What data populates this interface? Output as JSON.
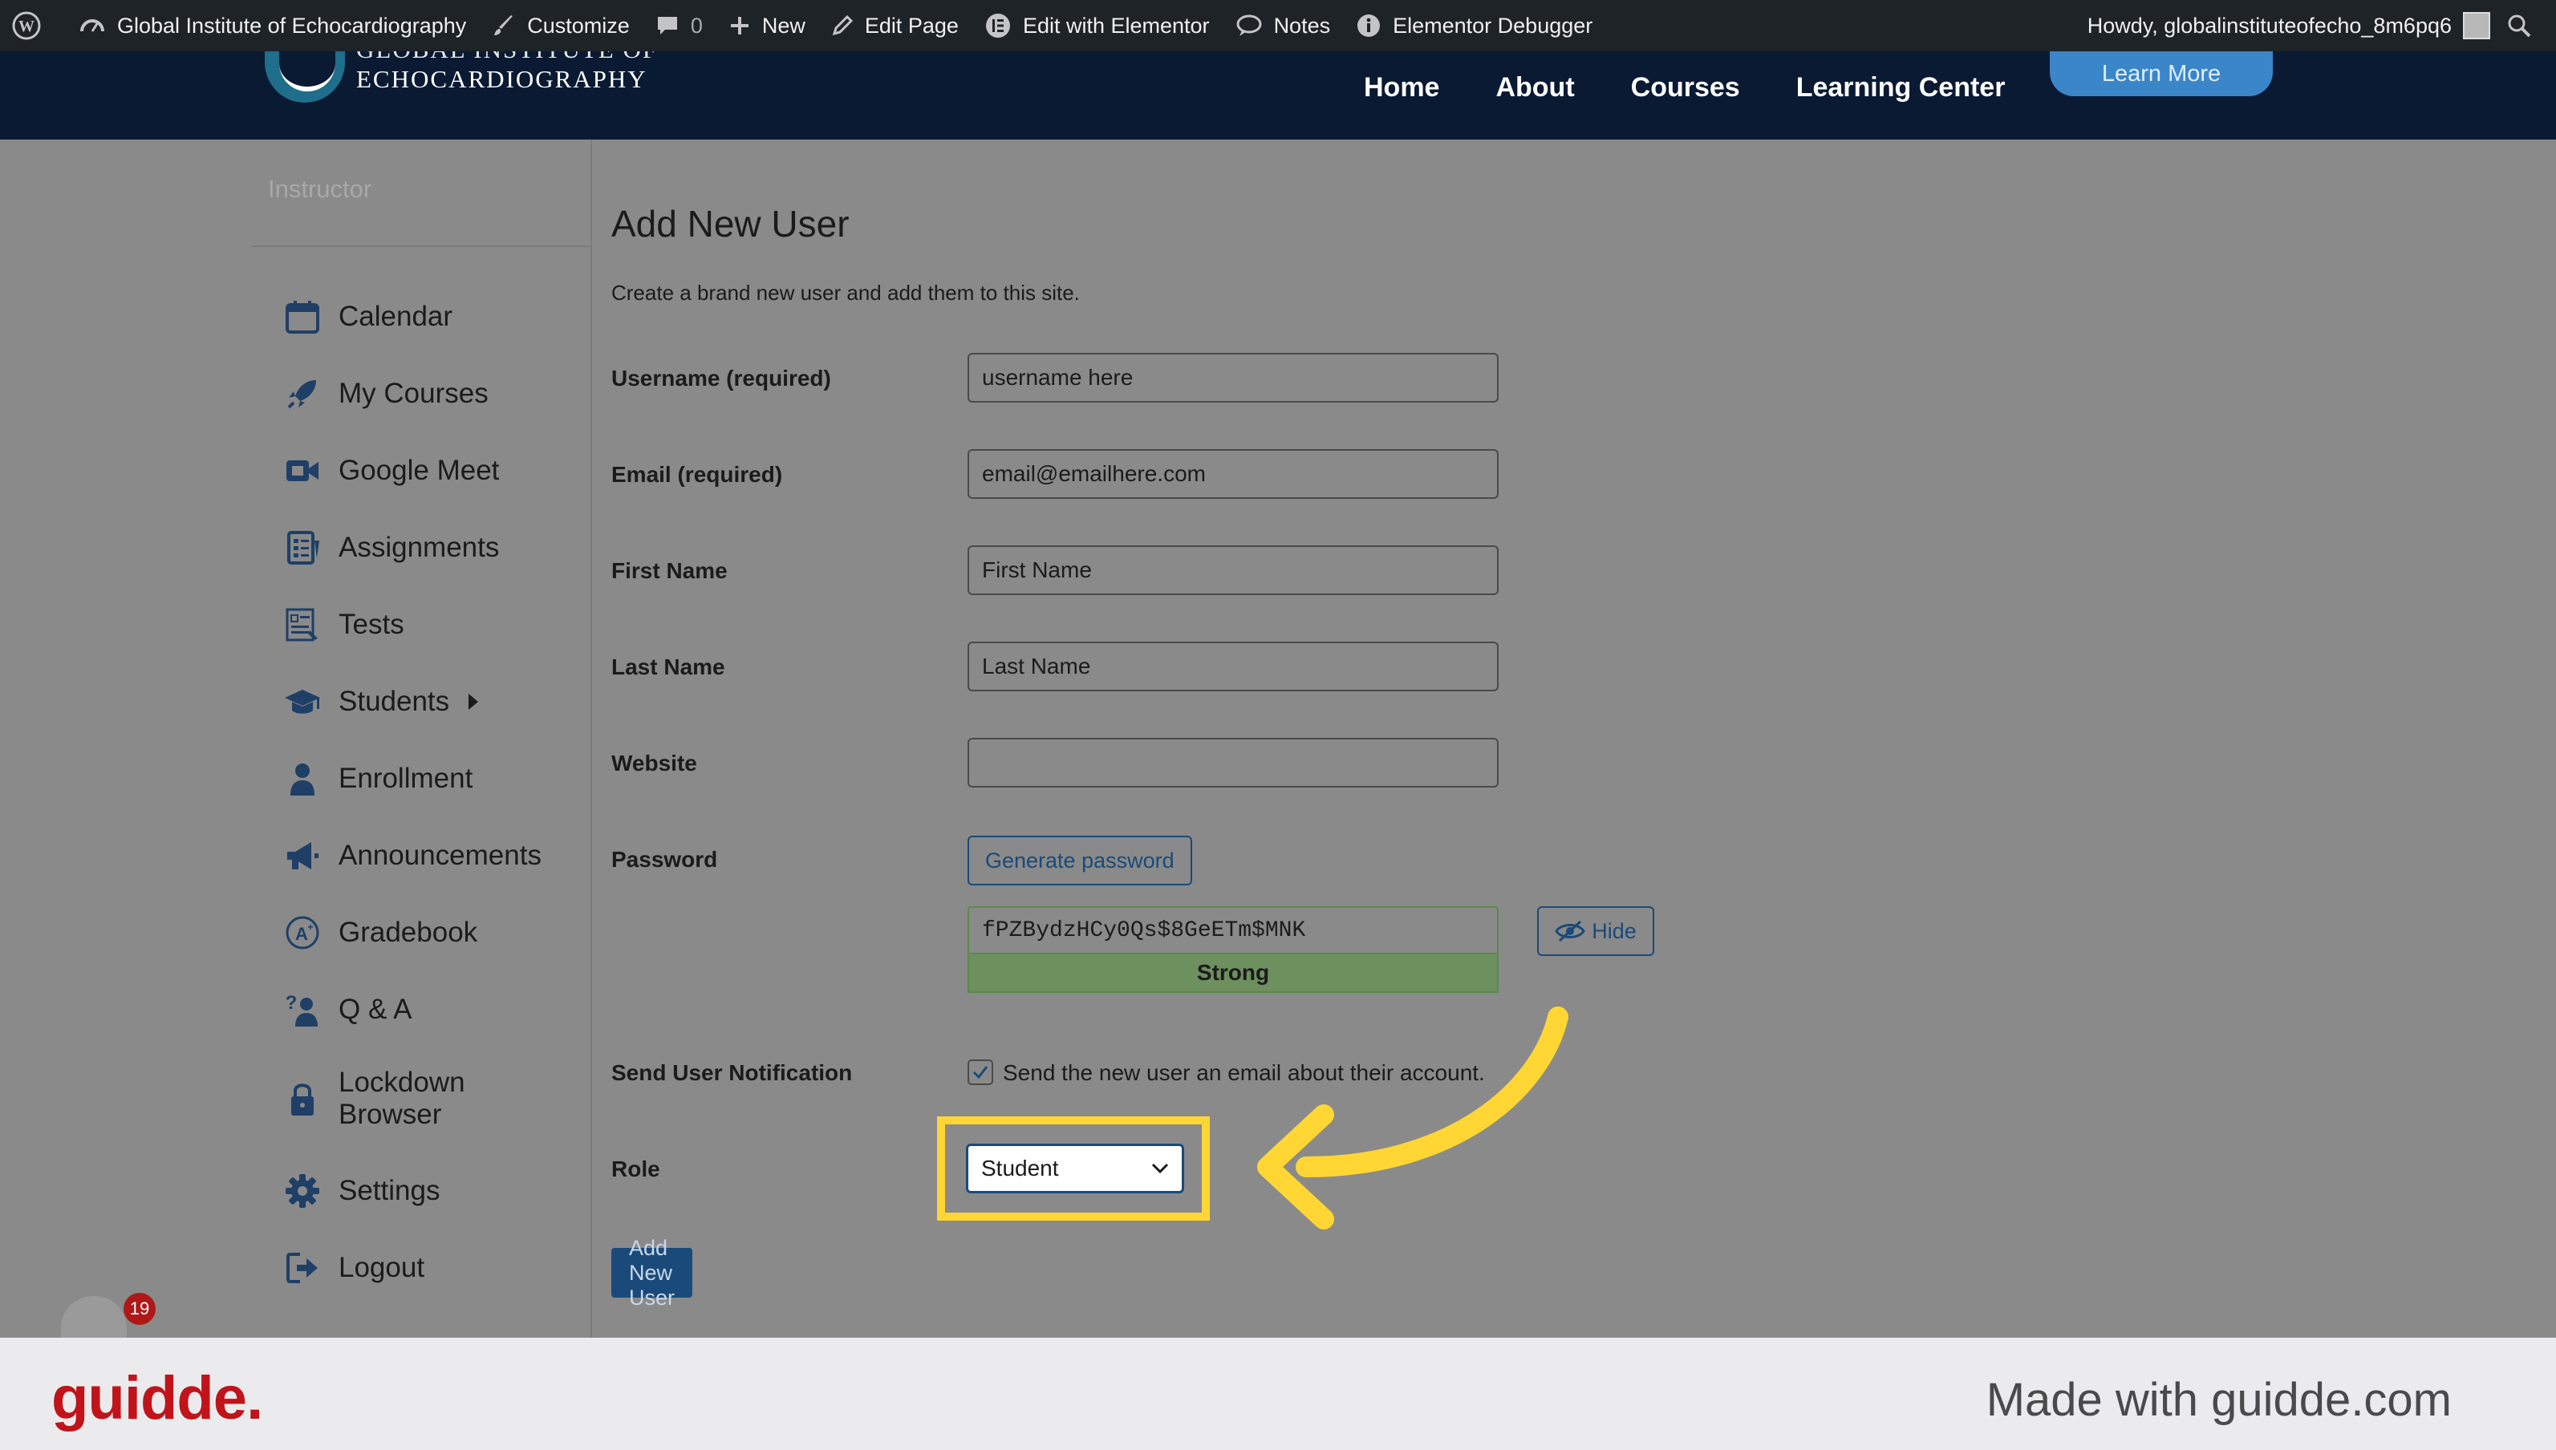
{
  "adminbar": {
    "site_name": "Global Institute of Echocardiography",
    "customize": "Customize",
    "comments_count": "0",
    "new": "New",
    "edit_page": "Edit Page",
    "edit_elementor": "Edit with Elementor",
    "notes": "Notes",
    "debugger": "Elementor Debugger",
    "howdy": "Howdy, globalinstituteofecho_8m6pq6"
  },
  "site": {
    "logo_line1": "GLOBAL INSTITUTE OF",
    "logo_line2": "ECHOCARDIOGRAPHY",
    "nav": [
      "Home",
      "About",
      "Courses",
      "Learning Center"
    ],
    "cta": "Learn More"
  },
  "sidebar": {
    "heading": "Instructor",
    "items": [
      {
        "label": "Calendar",
        "icon": "calendar-icon"
      },
      {
        "label": "My Courses",
        "icon": "rocket-icon"
      },
      {
        "label": "Google Meet",
        "icon": "video-camera-icon"
      },
      {
        "label": "Assignments",
        "icon": "checklist-icon"
      },
      {
        "label": "Tests",
        "icon": "test-document-icon"
      },
      {
        "label": "Students",
        "icon": "graduation-cap-icon"
      },
      {
        "label": "Enrollment",
        "icon": "person-icon"
      },
      {
        "label": "Announcements",
        "icon": "megaphone-icon"
      },
      {
        "label": "Gradebook",
        "icon": "grade-icon"
      },
      {
        "label": "Q & A",
        "icon": "question-person-icon"
      },
      {
        "label": "Lockdown\nBrowser",
        "label_line1": "Lockdown",
        "label_line2": "Browser",
        "icon": "lock-icon"
      },
      {
        "label": "Settings",
        "icon": "gear-icon"
      },
      {
        "label": "Logout",
        "icon": "logout-icon"
      }
    ]
  },
  "form": {
    "title": "Add New User",
    "description": "Create a brand new user and add them to this site.",
    "username": {
      "label": "Username (required)",
      "value": "username here"
    },
    "email": {
      "label": "Email (required)",
      "value": "email@emailhere.com"
    },
    "first_name": {
      "label": "First Name",
      "value": "First Name"
    },
    "last_name": {
      "label": "Last Name",
      "value": "Last Name"
    },
    "website": {
      "label": "Website",
      "value": ""
    },
    "password": {
      "label": "Password",
      "generate_label": "Generate password",
      "value": "fPZBydzHCy0Qs$8GeETm$MNK",
      "strength": "Strong",
      "hide_label": "Hide"
    },
    "notification": {
      "label": "Send User Notification",
      "checkbox_label": "Send the new user an email about their account.",
      "checked": true
    },
    "role": {
      "label": "Role",
      "selected": "Student"
    },
    "submit_label": "Add New User"
  },
  "help_badge_count": "19",
  "footer": {
    "brand": "guidde.",
    "made_with": "Made with guidde.com"
  },
  "colors": {
    "highlight": "#ffd633",
    "primary": "#1a4a7a",
    "brand": "#c0141a"
  }
}
